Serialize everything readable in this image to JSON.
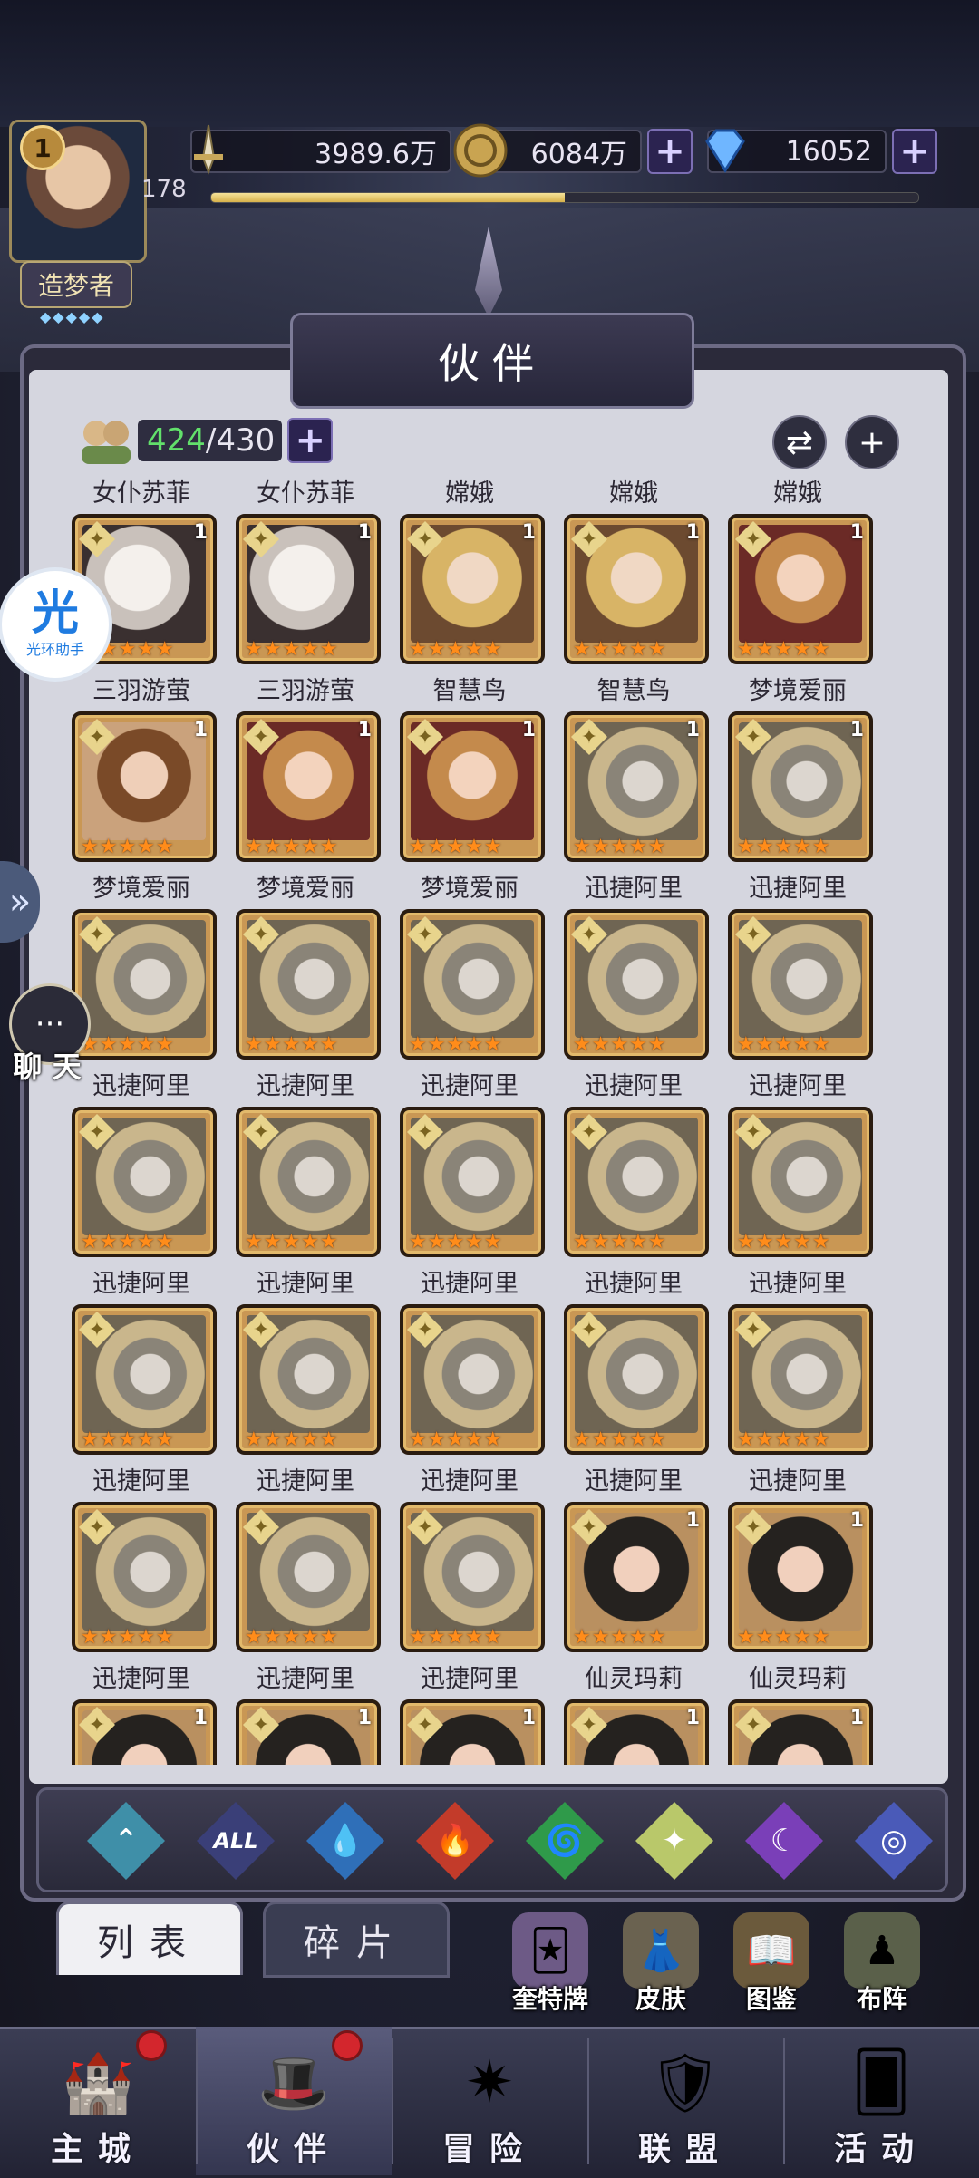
{
  "player": {
    "level": "1",
    "exp_value": "178",
    "exp_fraction": 0.5,
    "rank": "造梦者",
    "rank_stars": "◆◆◆◆◆"
  },
  "resources": {
    "power": "3989.6万",
    "gold": "6084万",
    "diamonds": "16052"
  },
  "floats": {
    "helper_big": "光",
    "helper_small": "光环助手",
    "chat_label": "聊 天"
  },
  "panel": {
    "title": "伙伴",
    "count_current": "424",
    "count_total": "/430"
  },
  "heroes": [
    {
      "name": "女仆苏菲",
      "lv": "1",
      "style": "white"
    },
    {
      "name": "女仆苏菲",
      "lv": "1",
      "style": "white"
    },
    {
      "name": "嫦娥",
      "lv": "1",
      "style": "change"
    },
    {
      "name": "嫦娥",
      "lv": "1",
      "style": "change"
    },
    {
      "name": "嫦娥",
      "lv": "1",
      "style": "wisdom"
    },
    {
      "name": "三羽游萤",
      "lv": "1",
      "style": "feather"
    },
    {
      "name": "三羽游萤",
      "lv": "1",
      "style": "wisdom"
    },
    {
      "name": "智慧鸟",
      "lv": "1",
      "style": "wisdom"
    },
    {
      "name": "智慧鸟",
      "lv": "1",
      "style": "ali"
    },
    {
      "name": "梦境爱丽",
      "lv": "1",
      "style": "ali"
    },
    {
      "name": "梦境爱丽",
      "lv": "",
      "style": "ali"
    },
    {
      "name": "梦境爱丽",
      "lv": "",
      "style": "ali"
    },
    {
      "name": "梦境爱丽",
      "lv": "",
      "style": "ali"
    },
    {
      "name": "迅捷阿里",
      "lv": "",
      "style": "ali"
    },
    {
      "name": "迅捷阿里",
      "lv": "",
      "style": "ali"
    },
    {
      "name": "迅捷阿里",
      "lv": "",
      "style": "ali"
    },
    {
      "name": "迅捷阿里",
      "lv": "",
      "style": "ali"
    },
    {
      "name": "迅捷阿里",
      "lv": "",
      "style": "ali"
    },
    {
      "name": "迅捷阿里",
      "lv": "",
      "style": "ali"
    },
    {
      "name": "迅捷阿里",
      "lv": "",
      "style": "ali"
    },
    {
      "name": "迅捷阿里",
      "lv": "",
      "style": "ali"
    },
    {
      "name": "迅捷阿里",
      "lv": "",
      "style": "ali"
    },
    {
      "name": "迅捷阿里",
      "lv": "",
      "style": "ali"
    },
    {
      "name": "迅捷阿里",
      "lv": "",
      "style": "ali"
    },
    {
      "name": "迅捷阿里",
      "lv": "",
      "style": "ali"
    },
    {
      "name": "迅捷阿里",
      "lv": "",
      "style": "ali"
    },
    {
      "name": "迅捷阿里",
      "lv": "",
      "style": "ali"
    },
    {
      "name": "迅捷阿里",
      "lv": "",
      "style": "ali"
    },
    {
      "name": "迅捷阿里",
      "lv": "1",
      "style": "mary"
    },
    {
      "name": "迅捷阿里",
      "lv": "1",
      "style": "mary"
    },
    {
      "name": "迅捷阿里",
      "lv": "1",
      "style": "mary"
    },
    {
      "name": "迅捷阿里",
      "lv": "1",
      "style": "mary"
    },
    {
      "name": "迅捷阿里",
      "lv": "1",
      "style": "mary"
    },
    {
      "name": "仙灵玛莉",
      "lv": "1",
      "style": "mary"
    },
    {
      "name": "仙灵玛莉",
      "lv": "1",
      "style": "mary"
    }
  ],
  "element_filters": [
    {
      "name": "element-wind",
      "glyph": "⌃",
      "color": "#3f8fa8"
    },
    {
      "name": "element-all",
      "glyph": "ALL",
      "color": "#3a3f78"
    },
    {
      "name": "element-water",
      "glyph": "💧",
      "color": "#2f6fb8"
    },
    {
      "name": "element-fire",
      "glyph": "🔥",
      "color": "#c33b2a"
    },
    {
      "name": "element-nature",
      "glyph": "🌀",
      "color": "#2f9a4a"
    },
    {
      "name": "element-light",
      "glyph": "✦",
      "color": "#b9c86a"
    },
    {
      "name": "element-dark",
      "glyph": "☾",
      "color": "#7a3fb8"
    },
    {
      "name": "element-void",
      "glyph": "◎",
      "color": "#4a5ab8"
    }
  ],
  "subtabs": {
    "list": "列表",
    "fragments": "碎片"
  },
  "tools": [
    {
      "name": "tarot-tool",
      "label": "奎特牌",
      "glyph": "🃏",
      "color": "#6d5a86"
    },
    {
      "name": "skin-tool",
      "label": "皮肤",
      "glyph": "👗",
      "color": "#6a6250"
    },
    {
      "name": "atlas-tool",
      "label": "图鉴",
      "glyph": "📖",
      "color": "#6b5a3c"
    },
    {
      "name": "formation-tool",
      "label": "布阵",
      "glyph": "♟",
      "color": "#5a604a"
    }
  ],
  "nav": [
    {
      "name": "nav-city",
      "label": "主城",
      "glyph": "🏰",
      "badge": true
    },
    {
      "name": "nav-partner",
      "label": "伙伴",
      "glyph": "🎩",
      "badge": true
    },
    {
      "name": "nav-adventure",
      "label": "冒险",
      "glyph": "✷",
      "badge": false
    },
    {
      "name": "nav-alliance",
      "label": "联盟",
      "glyph": "🛡",
      "badge": false
    },
    {
      "name": "nav-event",
      "label": "活动",
      "glyph": "🂠",
      "badge": false
    }
  ]
}
